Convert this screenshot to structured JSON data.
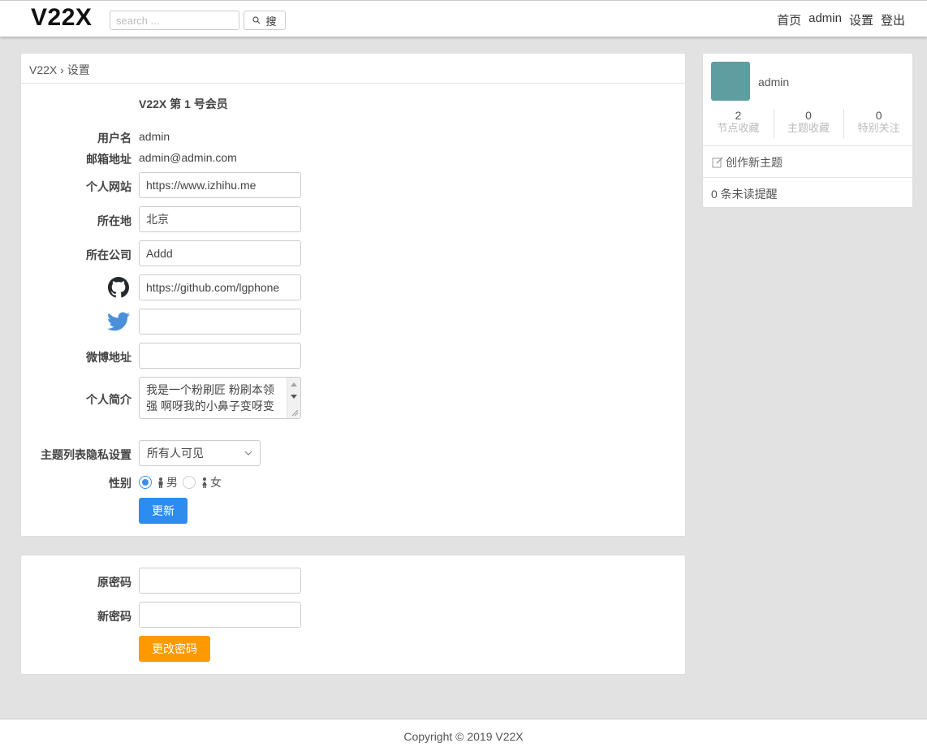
{
  "header": {
    "logo": "V22X",
    "search_placeholder": "search ...",
    "search_button": "搜",
    "nav": [
      "首页",
      "admin",
      "设置",
      "登出"
    ]
  },
  "breadcrumb": {
    "home": "V22X",
    "separator": "›",
    "current": "设置"
  },
  "profile": {
    "member_title": "V22X 第 1 号会员",
    "username_label": "用户名",
    "username": "admin",
    "email_label": "邮箱地址",
    "email": "admin@admin.com",
    "website_label": "个人网站",
    "website": "https://www.izhihu.me",
    "location_label": "所在地",
    "location": "北京",
    "company_label": "所在公司",
    "company": "Addd",
    "github_icon": "github-icon",
    "github": "https://github.com/lgphone",
    "twitter_icon": "twitter-icon",
    "twitter": "",
    "weibo_label": "微博地址",
    "weibo": "",
    "bio_label": "个人简介",
    "bio": "我是一个粉刷匠 粉刷本领强 啊呀我的小鼻子变呀变",
    "privacy_label": "主题列表隐私设置",
    "privacy_value": "所有人可见",
    "gender_label": "性别",
    "gender_options": [
      "男",
      "女"
    ],
    "gender_selected": "男",
    "update_button": "更新"
  },
  "password": {
    "old_label": "原密码",
    "new_label": "新密码",
    "submit_button": "更改密码"
  },
  "sidebar": {
    "username": "admin",
    "avatar_color": "#5f9ea0",
    "stats": [
      {
        "value": "2",
        "label": "节点收藏"
      },
      {
        "value": "0",
        "label": "主题收藏"
      },
      {
        "value": "0",
        "label": "特别关注"
      }
    ],
    "new_topic": "创作新主题",
    "unread": "0 条未读提醒"
  },
  "footer": {
    "copyright": "Copyright © 2019 V22X"
  },
  "colors": {
    "primary": "#2d8cf0",
    "warning": "#ff9900",
    "twitter": "#4a90d9"
  }
}
